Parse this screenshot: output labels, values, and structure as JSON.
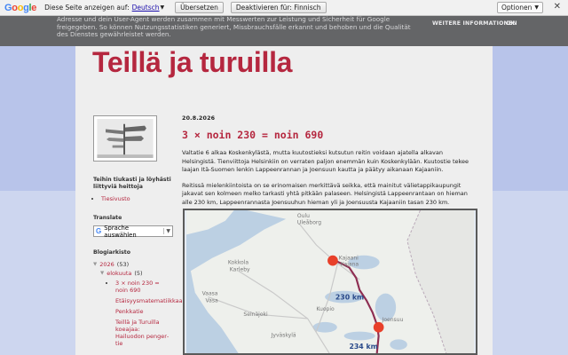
{
  "translate_bar": {
    "logo": "Google",
    "prompt": "Diese Seite anzeigen auf:",
    "language": "Deutsch",
    "translate_button": "Übersetzen",
    "disable_button": "Deaktivieren für: Finnisch",
    "options_button": "Optionen",
    "close": "✕"
  },
  "cookie_bar": {
    "text": "Adresse und dein User-Agent werden zusammen mit Messwerten zur Leistung und Sicherheit für Google freigegeben. So können Nutzungsstatistiken generiert, Missbrauchsfälle erkannt und behoben und die Qualität des Dienstes gewährleistet werden.",
    "more_info": "WEITERE INFORMATIONEN",
    "ok": "OK"
  },
  "blog": {
    "title": "Teillä ja turuilla"
  },
  "sidebar": {
    "links_heading": "Teihin tiukasti ja löyhästi liittyviä heittoja",
    "links": [
      "Tiesivusto"
    ],
    "translate_heading": "Translate",
    "translate_select": "Sprache auswählen",
    "archive_heading": "Blogiarkisto",
    "archive": {
      "year": "2026",
      "year_count": "(53)",
      "month": "elokuuta",
      "month_count": "(5)",
      "posts": [
        "3 × noin 230 = noin 690",
        "Etäisyysmatematiikkaa",
        "Penkkatie",
        "Teillä ja Turuilla koeajaa: Hailuodon penger­tie"
      ]
    }
  },
  "post": {
    "date": "20.8.2026",
    "title": "3 × noin 230 = noin 690",
    "paragraphs": [
      "Valtatie 6 alkaa Koskenkylästä, mutta kuutostieksi kutsutun reitin voidaan ajatella alkavan Helsingistä. Tienviittoja Helsinkiin on verraten paljon enemmän kuin Koskenkylään. Kuutostie tekee laajan Itä-Suomen lenkin Lappeenrannan ja Joensuun kautta ja päätyy aikanaan Kajaaniin.",
      "Reitissä mielenkiintoista on se erinomaisen merkittävä seikka, että mainitut välietappikaupungit jakavat sen kolmeen melko tarkasti yhtä pitkään palaseen. Helsingistä Lappeenrantaan on hieman alle 230 km, Lappeenrannasta Joensuuhun hieman yli ja Joensuusta Kajaaniin tasan 230 km."
    ]
  },
  "map": {
    "places": [
      "Oulu",
      "Uleåborg",
      "Kajaani",
      "Kajana",
      "Kokkola",
      "Karleby",
      "Vaasa",
      "Vasa",
      "Kuopio",
      "Seinäjoki",
      "Joensuu",
      "Jyväskylä"
    ],
    "route_color": "#8e2e52",
    "marker_color": "#e8402a",
    "distances": [
      "230 km",
      "234 km"
    ]
  }
}
